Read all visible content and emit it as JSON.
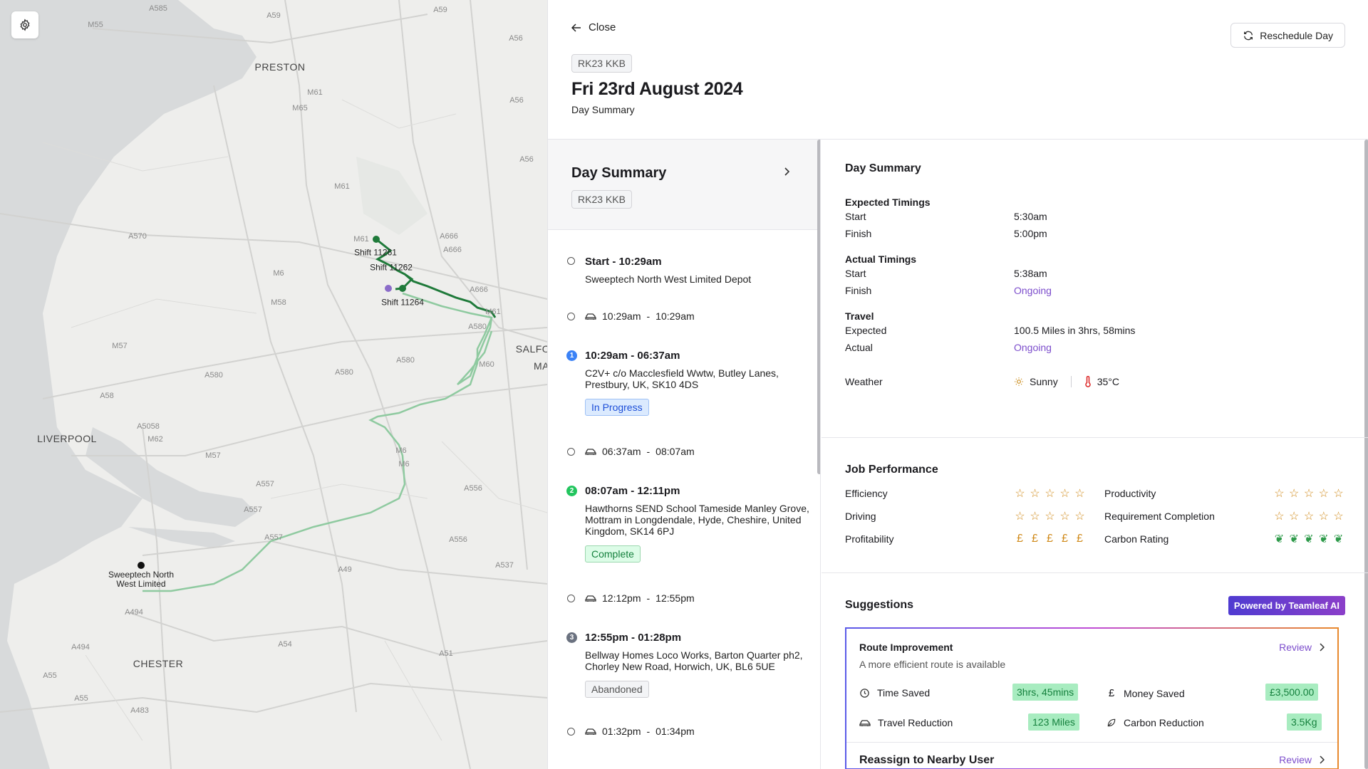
{
  "map": {
    "road_labels": [
      "A585",
      "M55",
      "A59",
      "A56",
      "M61",
      "M65",
      "A56",
      "A56",
      "M61",
      "A570",
      "A666",
      "A666",
      "M6",
      "M58",
      "A666",
      "M61",
      "A580",
      "M57",
      "A580",
      "A580",
      "M60",
      "A58",
      "A5058",
      "M62",
      "M57",
      "M6",
      "M6",
      "A557",
      "A556",
      "A557",
      "A557",
      "A556",
      "A537",
      "A49",
      "A494",
      "A494",
      "A54",
      "A51",
      "A55",
      "A483"
    ],
    "cities": [
      "PRESTON",
      "LIVERPOOL",
      "CHESTER",
      "SALFO",
      "MA"
    ],
    "markers": {
      "shift_a": "Shift 11261",
      "shift_b": "Shift 11262",
      "shift_c": "Shift 11264",
      "depot": "Sweeptech North West Limited"
    },
    "colors": {
      "route": "#1f7a3a",
      "route_faded": "#8fcaa0",
      "purple_dot": "#8b6cc9"
    }
  },
  "settings_icon": "gear-icon",
  "header": {
    "close_label": "Close",
    "plate": "RK23 KKB",
    "date": "Fri 23rd August 2024",
    "subtitle": "Day Summary",
    "reschedule_label": "Reschedule Day"
  },
  "timeline": {
    "summary_title": "Day Summary",
    "summary_plate": "RK23 KKB",
    "items": [
      {
        "kind": "stop",
        "title": "Start - 10:29am",
        "address": "Sweeptech North West Limited Depot"
      },
      {
        "kind": "travel",
        "from": "10:29am",
        "to": "10:29am"
      },
      {
        "kind": "job",
        "number": "1",
        "title": "10:29am - 06:37am",
        "address": "C2V+ c/o Macclesfield Wwtw, Butley Lanes, Prestbury, UK, SK10 4DS",
        "status": "In Progress",
        "color": "#3b82f6"
      },
      {
        "kind": "travel",
        "from": "06:37am",
        "to": "08:07am"
      },
      {
        "kind": "job",
        "number": "2",
        "title": "08:07am - 12:11pm",
        "address": "Hawthorns SEND School Tameside Manley Grove, Mottram in Longdendale, Hyde, Cheshire, United Kingdom, SK14 6PJ",
        "status": "Complete",
        "color": "#22c55e"
      },
      {
        "kind": "travel",
        "from": "12:12pm",
        "to": "12:55pm"
      },
      {
        "kind": "job",
        "number": "3",
        "title": "12:55pm - 01:28pm",
        "address": "Bellway Homes Loco Works, Barton Quarter ph2, Chorley New Road, Horwich, UK, BL6 5UE",
        "status": "Abandoned",
        "color": "#6b7280"
      },
      {
        "kind": "travel",
        "from": "01:32pm",
        "to": "01:34pm"
      }
    ]
  },
  "details": {
    "title": "Day Summary",
    "expected": {
      "title": "Expected Timings",
      "start_label": "Start",
      "start": "5:30am",
      "finish_label": "Finish",
      "finish": "5:00pm"
    },
    "actual": {
      "title": "Actual Timings",
      "start_label": "Start",
      "start": "5:38am",
      "finish_label": "Finish",
      "finish": "Ongoing"
    },
    "travel": {
      "title": "Travel",
      "expected_label": "Expected",
      "expected": "100.5 Miles in 3hrs, 58mins",
      "actual_label": "Actual",
      "actual": "Ongoing"
    },
    "weather": {
      "label": "Weather",
      "condition": "Sunny",
      "temp": "35°C"
    }
  },
  "performance": {
    "title": "Job Performance",
    "metrics": [
      {
        "label": "Efficiency",
        "icon": "star",
        "rating": 0,
        "max": 5
      },
      {
        "label": "Productivity",
        "icon": "star",
        "rating": 0,
        "max": 5
      },
      {
        "label": "Driving",
        "icon": "star",
        "rating": 0,
        "max": 5
      },
      {
        "label": "Requirement Completion",
        "icon": "star",
        "rating": 0,
        "max": 5
      },
      {
        "label": "Profitability",
        "icon": "pound",
        "rating": 5,
        "max": 5
      },
      {
        "label": "Carbon Rating",
        "icon": "leaf",
        "rating": 5,
        "max": 5
      }
    ]
  },
  "suggestions": {
    "title": "Suggestions",
    "ai_badge": "Powered by Teamleaf AI",
    "route": {
      "title": "Route Improvement",
      "review": "Review",
      "description": "A more efficient route is available",
      "time_saved_label": "Time Saved",
      "time_saved": "3hrs, 45mins",
      "money_saved_label": "Money Saved",
      "money_saved": "£3,500.00",
      "travel_label": "Travel Reduction",
      "travel": "123 Miles",
      "carbon_label": "Carbon Reduction",
      "carbon": "3.5Kg"
    },
    "reassign": {
      "title": "Reassign to Nearby User",
      "review": "Review"
    }
  }
}
